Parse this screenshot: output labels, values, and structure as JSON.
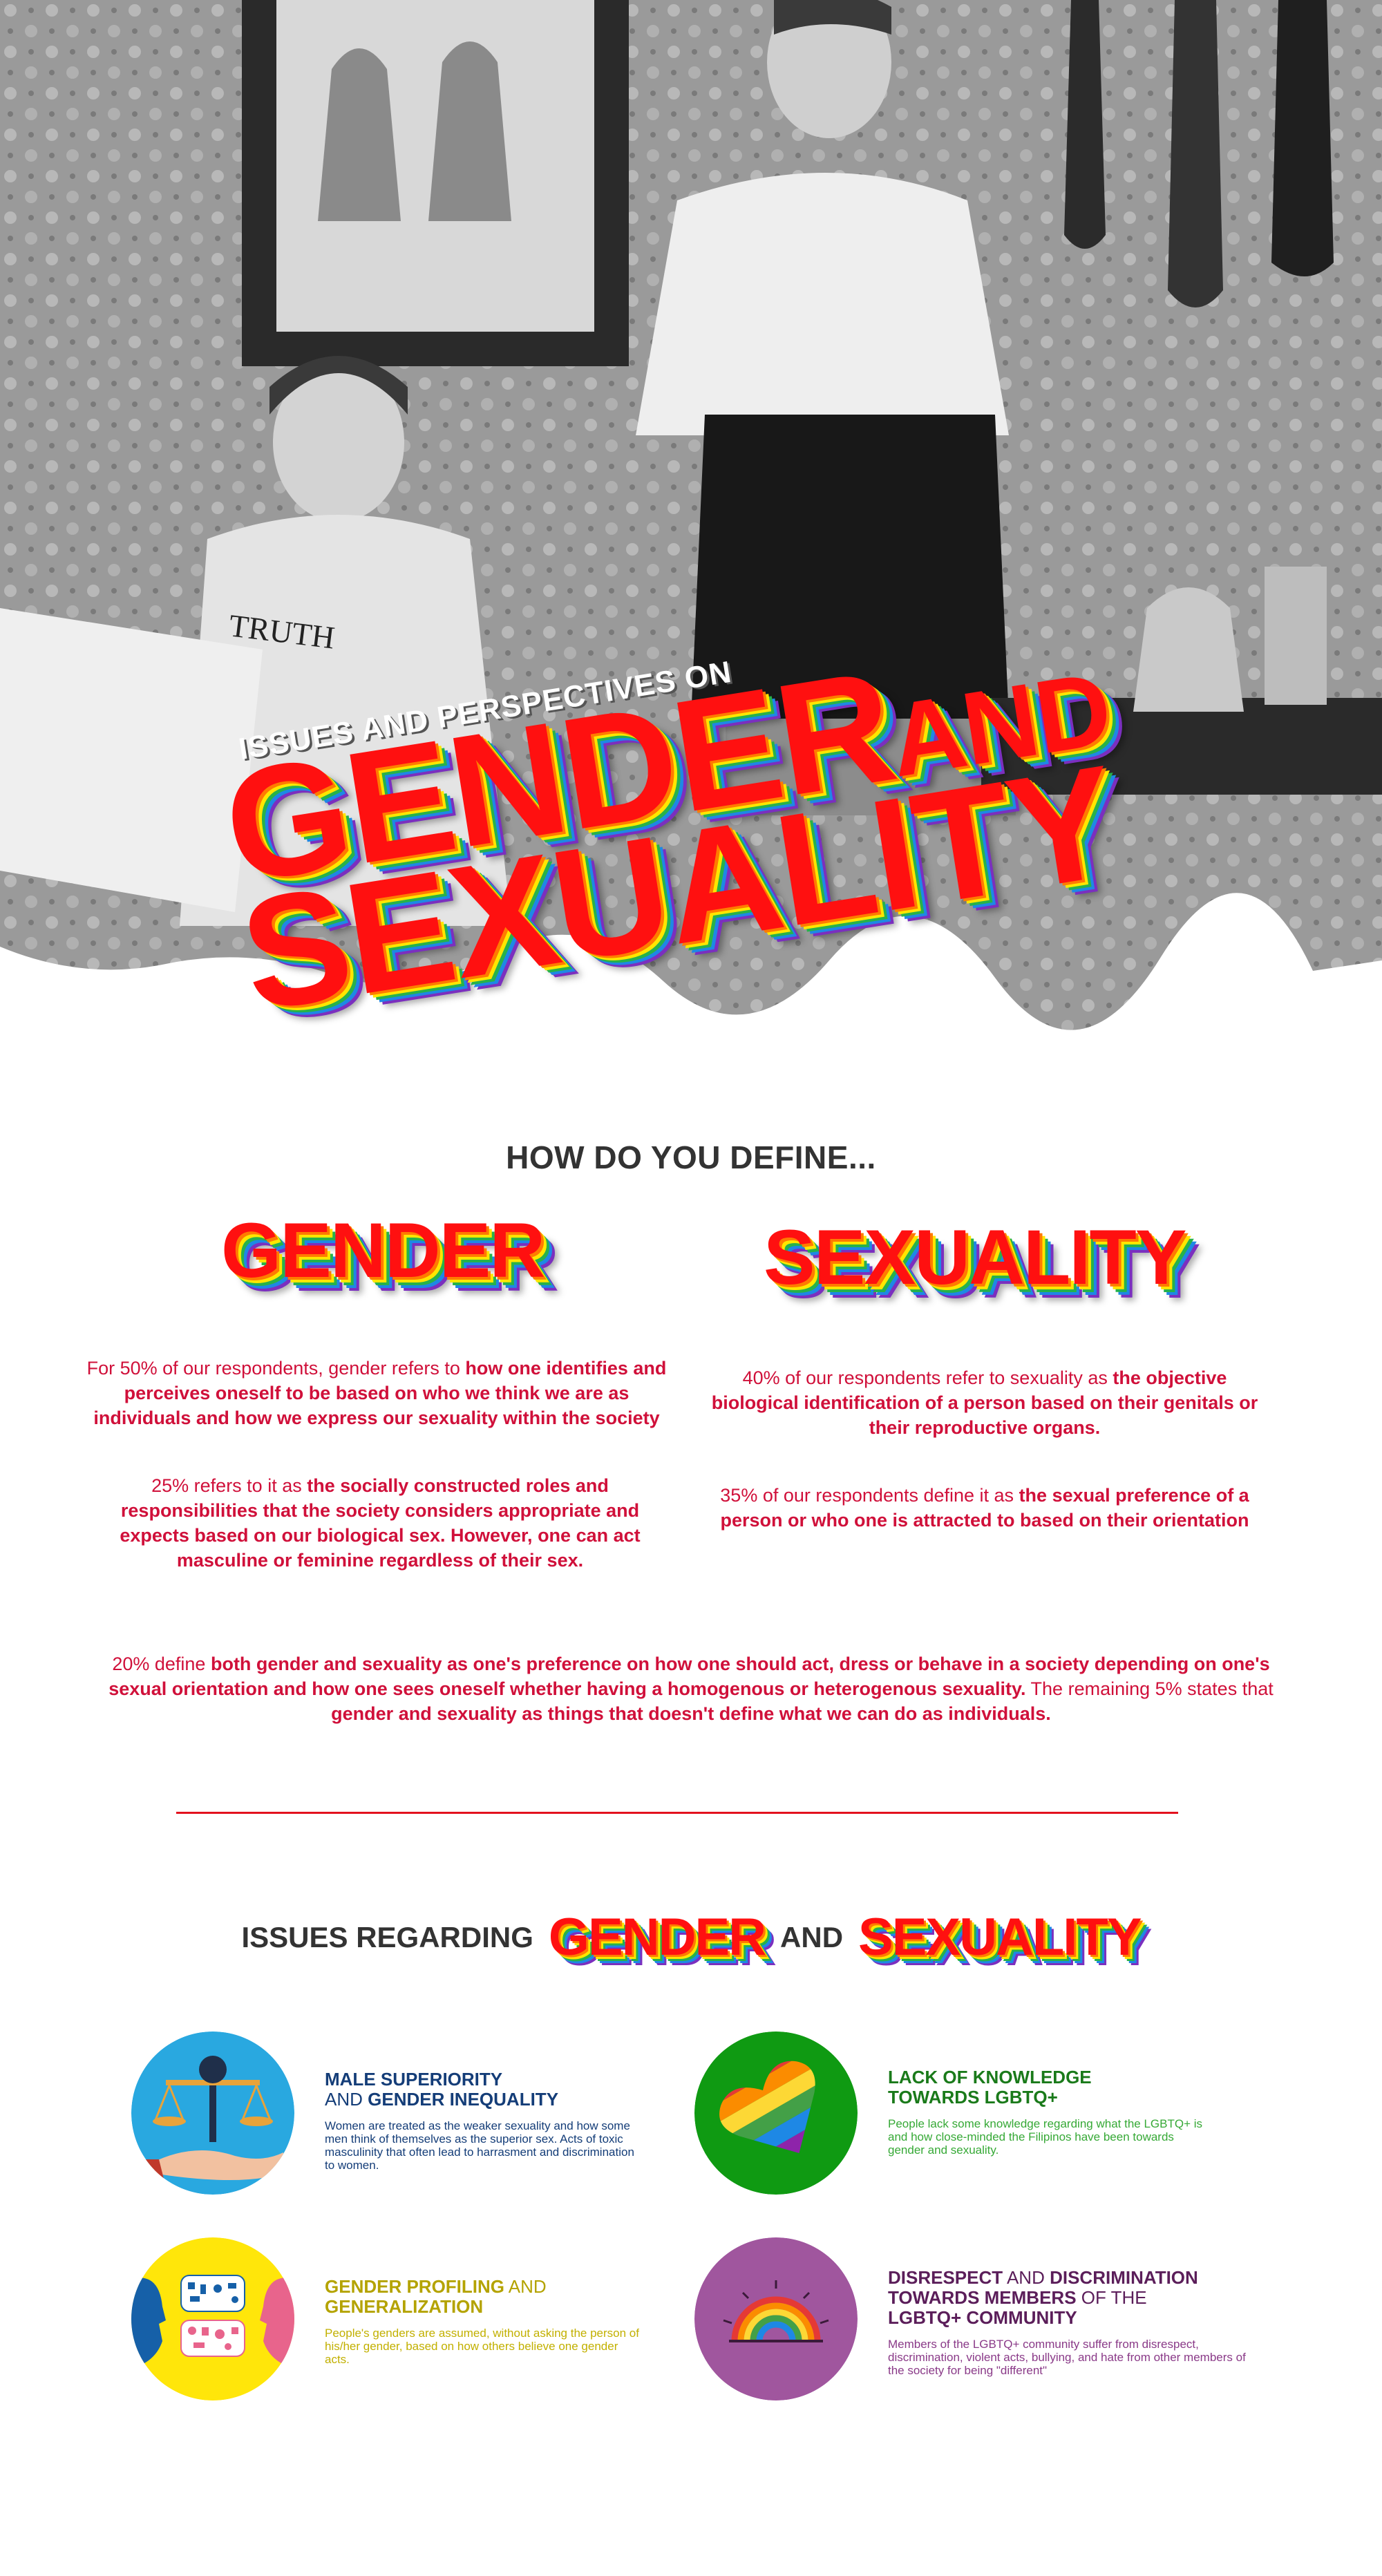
{
  "hero": {
    "kicker": "ISSUES AND PERSPECTIVES ON",
    "title_line1": "GENDER",
    "title_and": "AND",
    "title_line2": "SEXUALITY",
    "photo_sign": "TRUTH"
  },
  "define": {
    "heading": "HOW DO YOU DEFINE...",
    "gender_title": "GENDER",
    "sexuality_title": "SEXUALITY",
    "gender_p1": {
      "lead": "For 50% of our respondents, gender refers to ",
      "bold": "how one identifies and perceives oneself to be based on who we think we are as individuals and how we express our sexuality within the society"
    },
    "gender_p2": {
      "lead": "25% refers to it as ",
      "bold": "the socially constructed roles and responsibilities that the society considers appropriate and expects  based on our biological sex.  However, one can act masculine or feminine  regardless of their sex."
    },
    "sexuality_p1": {
      "lead": "40% of our respondents refer to sexuality as ",
      "bold": "the objective biological identification of a person based on their genitals or their reproductive organs."
    },
    "sexuality_p2": {
      "lead": "35% of our respondents define it as ",
      "bold": "the sexual preference of a person or who one is attracted to based on their orientation"
    },
    "both": {
      "lead": "20% define ",
      "bold1": "both gender and sexuality as one's preference on how one should act, dress or behave in a society depending on one's sexual orientation and how one sees oneself whether having a homogenous or heterogenous sexuality.",
      "mid": " The remaining 5% states that ",
      "bold2": "gender and sexuality as things that doesn't define what we can do as individuals."
    }
  },
  "issues": {
    "heading_prefix": "ISSUES REGARDING",
    "heading_gender": "GENDER",
    "heading_and": "AND",
    "heading_sexuality": "SEXUALITY",
    "items": [
      {
        "icon": "scale-icon",
        "title_a": "MALE SUPERIORITY",
        "title_b_light": "AND ",
        "title_b": "GENDER INEQUALITY",
        "body": "Women are treated as the weaker sexuality and how some men think of themselves as the superior sex. Acts of toxic masculinity that often lead to harrasment and discrimination to women.",
        "color": "#143d78"
      },
      {
        "icon": "rainbow-heart-icon",
        "title_a": "LACK OF KNOWLEDGE",
        "title_b": "TOWARDS LGBTQ+",
        "body": "People lack some knowledge regarding what the LGBTQ+ is and how close-minded the Filipinos have been towards gender and sexuality.",
        "color": "#1a7a1a"
      },
      {
        "icon": "profiling-faces-icon",
        "title_a": "GENDER PROFILING",
        "title_a_light": " AND",
        "title_b": "GENERALIZATION",
        "body": "People's genders are assumed, without asking the person of his/her gender, based on how others believe one gender acts.",
        "color": "#b4a300"
      },
      {
        "icon": "rainbow-icon",
        "title_a": "DISRESPECT",
        "title_a_light": " AND ",
        "title_a2": "DISCRIMINATION",
        "title_b": "TOWARDS MEMBERS",
        "title_b_light": " OF THE",
        "title_c": "LGBTQ+ COMMUNITY",
        "body": "Members of the LGBTQ+ community suffer from disrespect, discrimination, violent acts, bullying, and hate from other members of the society for being \"different\"",
        "color": "#5b1e5a"
      }
    ]
  }
}
